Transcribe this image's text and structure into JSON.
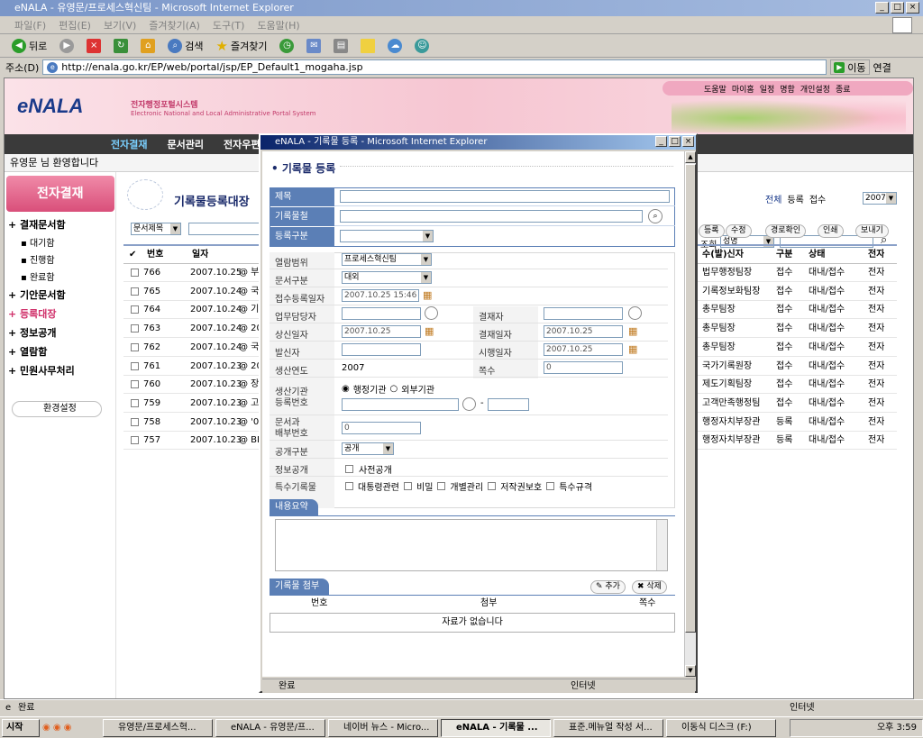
{
  "browser": {
    "title": "eNALA - 유영문/프로세스혁신팀 - Microsoft Internet Explorer",
    "menus": [
      "파일(F)",
      "편집(E)",
      "보기(V)",
      "즐겨찾기(A)",
      "도구(T)",
      "도움말(H)"
    ],
    "back_label": "뒤로",
    "search_label": "검색",
    "favorites_label": "즐겨찾기",
    "address_label": "주소(D)",
    "url": "http://enala.go.kr/EP/web/portal/jsp/EP_Default1_mogaha.jsp",
    "go_label": "이동",
    "links_label": "연결",
    "status_text": "완료",
    "zone_text": "인터넷"
  },
  "portal": {
    "logo": "eNALA",
    "logo_sub_kr": "전자행정포털시스템",
    "logo_sub_en": "Electronic National and Local Administrative Portal System",
    "top_links": [
      "도움말",
      "마이홈",
      "일정",
      "명함",
      "개인설정",
      "종료"
    ],
    "nav": [
      "전자결재",
      "문서관리",
      "전자우편"
    ],
    "welcome": "유영문 님 환영합니다",
    "side_title": "전자결재",
    "side_menu": [
      {
        "label": "결재문서함",
        "children": [
          "대기함",
          "진행함",
          "완료함"
        ]
      },
      {
        "label": "기안문서함"
      },
      {
        "label": "등록대장"
      },
      {
        "label": "정보공개"
      },
      {
        "label": "열람함"
      },
      {
        "label": "민원사무처리"
      }
    ],
    "settings": "환경설정",
    "main_title": "기록물등록대장",
    "filter_select": "문서제목",
    "right_search_label": "조회",
    "right_search_select": "성명",
    "tabs": [
      "전체",
      "등록",
      "접수"
    ],
    "year": "2007",
    "actions": [
      "등록",
      "수정",
      "경로확인",
      "인쇄",
      "보내기"
    ],
    "columns": [
      "번호",
      "일자",
      "수(발)신자",
      "구분",
      "상태",
      "전자"
    ],
    "rows": [
      {
        "no": "766",
        "date": "2007.10.25",
        "title": "@ 부",
        "sender": "법무행정팀장",
        "kind": "접수",
        "state": "대내/접수",
        "elec": "전자"
      },
      {
        "no": "765",
        "date": "2007.10.24",
        "title": "@ 국",
        "sender": "기록정보화팀장",
        "kind": "접수",
        "state": "대내/접수",
        "elec": "전자"
      },
      {
        "no": "764",
        "date": "2007.10.24",
        "title": "@ 기",
        "sender": "총무팀장",
        "kind": "접수",
        "state": "대내/접수",
        "elec": "전자"
      },
      {
        "no": "763",
        "date": "2007.10.24",
        "title": "@ 20",
        "sender": "총무팀장",
        "kind": "접수",
        "state": "대내/접수",
        "elec": "전자"
      },
      {
        "no": "762",
        "date": "2007.10.24",
        "title": "@ 국",
        "sender": "총무팀장",
        "kind": "접수",
        "state": "대내/접수",
        "elec": "전자"
      },
      {
        "no": "761",
        "date": "2007.10.23",
        "title": "@ 20",
        "sender": "국가기록원장",
        "kind": "접수",
        "state": "대내/접수",
        "elec": "전자"
      },
      {
        "no": "760",
        "date": "2007.10.23",
        "title": "@ 장",
        "sender": "제도기획팀장",
        "kind": "접수",
        "state": "대내/접수",
        "elec": "전자"
      },
      {
        "no": "759",
        "date": "2007.10.23",
        "title": "@ 고",
        "sender": "고객만족행정팀",
        "kind": "접수",
        "state": "대내/접수",
        "elec": "전자"
      },
      {
        "no": "758",
        "date": "2007.10.23",
        "title": "@ '07",
        "sender": "행정자치부장관",
        "kind": "등록",
        "state": "대내/접수",
        "elec": "전자"
      },
      {
        "no": "757",
        "date": "2007.10.23",
        "title": "@ BR",
        "sender": "행정자치부장관",
        "kind": "등록",
        "state": "대내/접수",
        "elec": "전자"
      }
    ]
  },
  "popup": {
    "title": "eNALA - 기록물 등록 - Microsoft Internet Explorer",
    "heading": "기록물 등록",
    "labels": {
      "subject": "제목",
      "folder": "기록물철",
      "reg_type": "등록구분",
      "scope": "열람범위",
      "doc_type": "문서구분",
      "recv_date": "접수등록일자",
      "handler": "업무담당자",
      "approver": "결재자",
      "report_date": "상신일자",
      "approve_date": "결재일자",
      "sender": "발신자",
      "effective_date": "시행일자",
      "prod_year": "생산연도",
      "pages": "쪽수",
      "org_reg_no": "생산기관\n등록번호",
      "dist_no": "문서과\n배부번호",
      "public_type": "공개구분",
      "info_public": "정보공개",
      "special": "특수기록물"
    },
    "values": {
      "scope": "프로세스혁신팀",
      "doc_type": "대외",
      "recv_date": "2007.10.25 15:46",
      "report_date": "2007.10.25",
      "approve_date": "2007.10.25",
      "effective_date": "2007.10.25",
      "prod_year": "2007",
      "pages": "0",
      "dist_no": "0",
      "public_type": "공개",
      "org_radio_1": "행정기관",
      "org_radio_2": "외부기관",
      "pre_public": "사전공개",
      "special_options": [
        "대통령관련",
        "비밀",
        "개별관리",
        "저작권보호",
        "특수규격"
      ]
    },
    "summary_tab": "내용요약",
    "attach_tab": "기록물 첨부",
    "add_btn": "추가",
    "del_btn": "삭제",
    "attach_cols": [
      "번호",
      "첨부",
      "쪽수"
    ],
    "no_data": "자료가 없습니다",
    "status": "완료",
    "zone": "인터넷"
  },
  "taskbar": {
    "start": "시작",
    "tasks": [
      "유영문/프로세스혁...",
      "eNALA - 유영문/프...",
      "네이버 뉴스 - Micro...",
      "eNALA - 기록물 ...",
      "표준.메뉴얼 작성 서...",
      "이동식 디스크 (F:)"
    ],
    "clock": "오후 3:59"
  }
}
